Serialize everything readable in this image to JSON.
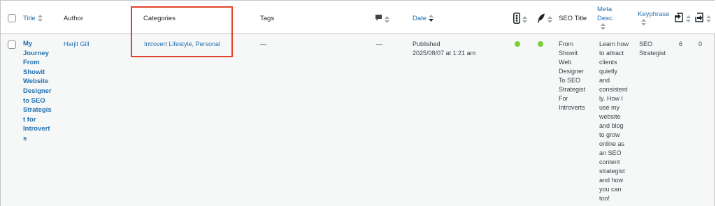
{
  "columns": {
    "title": "Title",
    "author": "Author",
    "categories": "Categories",
    "tags": "Tags",
    "date": "Date",
    "seo_title": "SEO Title",
    "meta_desc_line1": "Meta",
    "meta_desc_line2": "Desc.",
    "keyphrase": "Keyphrase"
  },
  "row": {
    "title_lines": [
      "My",
      "Journey",
      "From",
      "Showit",
      "Website",
      "Designer",
      "to SEO",
      "Strategis",
      "t for",
      "Introvert",
      "s"
    ],
    "author": "Harjit Gill",
    "categories": "Introvert Lifestyle, Personal",
    "tags": "—",
    "comments": "—",
    "date_status": "Published",
    "date_value": "2025/08/07 at 1:21 am",
    "seo_score_color": "#7ad03a",
    "readability_color": "#7ad03a",
    "seo_title_lines": [
      "From",
      "Showit",
      "Web",
      "Designer",
      "To SEO",
      "Strategist",
      "For",
      "Introverts"
    ],
    "meta_desc_lines": [
      "Learn how",
      "to attract",
      "clients",
      "quietly",
      "and",
      "consistent",
      "ly. How I",
      "use my",
      "website",
      "and blog",
      "to grow",
      "online as",
      "an SEO",
      "content",
      "strategist",
      "and how",
      "you can",
      "too!"
    ],
    "keyphrase_lines": [
      "SEO",
      "Strategist"
    ],
    "internal_links": "6",
    "incoming_links": "0"
  },
  "icons": {
    "comments": "comment-bubble-icon",
    "seo_score": "traffic-light-icon",
    "readability": "feather-icon",
    "internal_links": "outgoing-link-icon",
    "incoming_links": "incoming-link-icon"
  },
  "colors": {
    "link": "#2271b1",
    "highlight_border": "#e0432b",
    "score_good": "#7ad03a"
  }
}
